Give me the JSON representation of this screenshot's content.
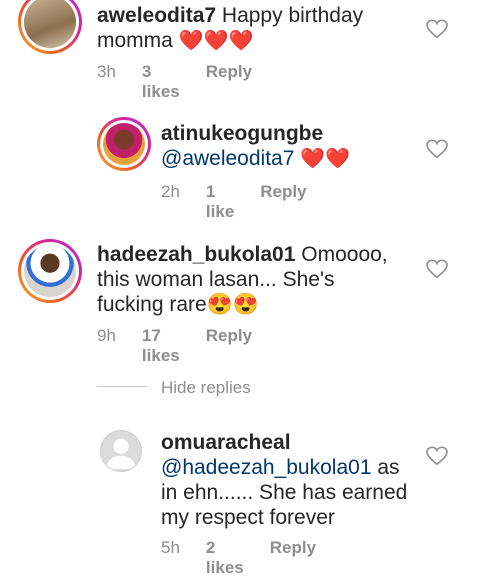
{
  "comments": [
    {
      "username": "aweleodita7",
      "text_part1": "Happy birthday",
      "text_part2": "momma",
      "emoji": "❤️❤️❤️",
      "time": "3h",
      "likes": "3 likes",
      "reply": "Reply"
    },
    {
      "username": "atinukeogungbe",
      "mention": "@aweleodita7",
      "emoji": "❤️❤️",
      "time": "2h",
      "likes": "1 like",
      "reply": "Reply"
    },
    {
      "username": "hadeezah_bukola01",
      "text_part1": "Omoooo,",
      "text_part2": "this woman lasan... She's",
      "text_part3": "fucking rare",
      "emoji": "😍😍",
      "time": "9h",
      "likes": "17 likes",
      "reply": "Reply"
    },
    {
      "username": "omuaracheal",
      "mention": "@hadeezah_bukola01",
      "text_part1": "as",
      "text_part2": "in ehn...... She has earned",
      "text_part3": "my respect forever",
      "time": "5h",
      "likes": "2 likes",
      "reply": "Reply"
    }
  ],
  "hide_replies": "Hide replies",
  "icons": {
    "like": "heart-outline-icon"
  },
  "colors": {
    "mention": "#00376b",
    "meta": "#8e8e8e"
  }
}
